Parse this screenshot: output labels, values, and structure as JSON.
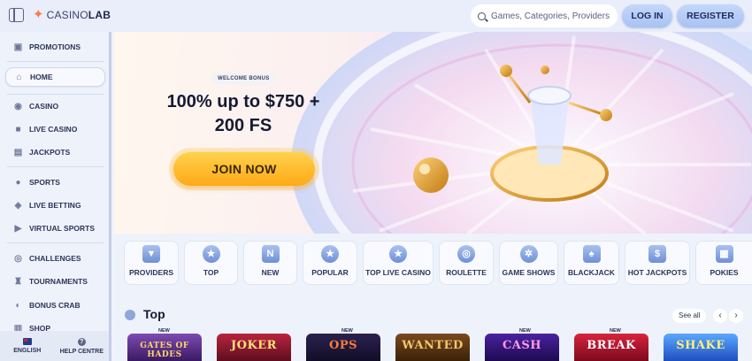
{
  "header": {
    "logo_text": "CASINO",
    "logo_text_bold": "LAB",
    "search_placeholder": "Games, Categories, Providers",
    "login_label": "LOG IN",
    "register_label": "REGISTER"
  },
  "sidebar": {
    "items": [
      {
        "label": "PROMOTIONS",
        "icon": "gift-icon"
      },
      {
        "label": "HOME",
        "icon": "home-icon"
      },
      {
        "label": "CASINO",
        "icon": "chip-icon"
      },
      {
        "label": "LIVE CASINO",
        "icon": "camera-icon"
      },
      {
        "label": "JACKPOTS",
        "icon": "jackpot-icon"
      },
      {
        "label": "SPORTS",
        "icon": "ball-icon"
      },
      {
        "label": "LIVE BETTING",
        "icon": "live-betting-icon"
      },
      {
        "label": "VIRTUAL SPORTS",
        "icon": "play-icon"
      },
      {
        "label": "CHALLENGES",
        "icon": "target-icon"
      },
      {
        "label": "TOURNAMENTS",
        "icon": "trophy-icon"
      },
      {
        "label": "BONUS CRAB",
        "icon": "crab-icon"
      },
      {
        "label": "SHOP",
        "icon": "shop-icon"
      }
    ],
    "language": "ENGLISH",
    "help": "HELP CENTRE"
  },
  "hero": {
    "badge": "WELCOME BONUS",
    "title_line1": "100% up to $750 +",
    "title_line2": "200 FS",
    "cta": "JOIN NOW"
  },
  "categories": [
    {
      "label": "PROVIDERS"
    },
    {
      "label": "TOP"
    },
    {
      "label": "NEW"
    },
    {
      "label": "POPULAR"
    },
    {
      "label": "TOP LIVE CASINO"
    },
    {
      "label": "ROULETTE"
    },
    {
      "label": "GAME SHOWS"
    },
    {
      "label": "BLACKJACK"
    },
    {
      "label": "HOT JACKPOTS"
    },
    {
      "label": "POKIES"
    }
  ],
  "top_section": {
    "title": "Top",
    "see_all": "See all",
    "new_tag": "NEW",
    "games": [
      {
        "title": "GATES OF HADES",
        "color": "#5b2d8a"
      },
      {
        "title": "JOKER",
        "color": "#7a1430"
      },
      {
        "title": "OPS",
        "color": "#16122e"
      },
      {
        "title": "WANTED",
        "color": "#5a3214"
      },
      {
        "title": "CASH",
        "color": "#2a145e"
      },
      {
        "title": "BREAK",
        "color": "#a0132e"
      },
      {
        "title": "SHAKE",
        "color": "#1f6ad8"
      }
    ]
  },
  "colors": {
    "accent": "#a8c2f2",
    "cta": "#ffb31f",
    "text": "#1d2545"
  }
}
